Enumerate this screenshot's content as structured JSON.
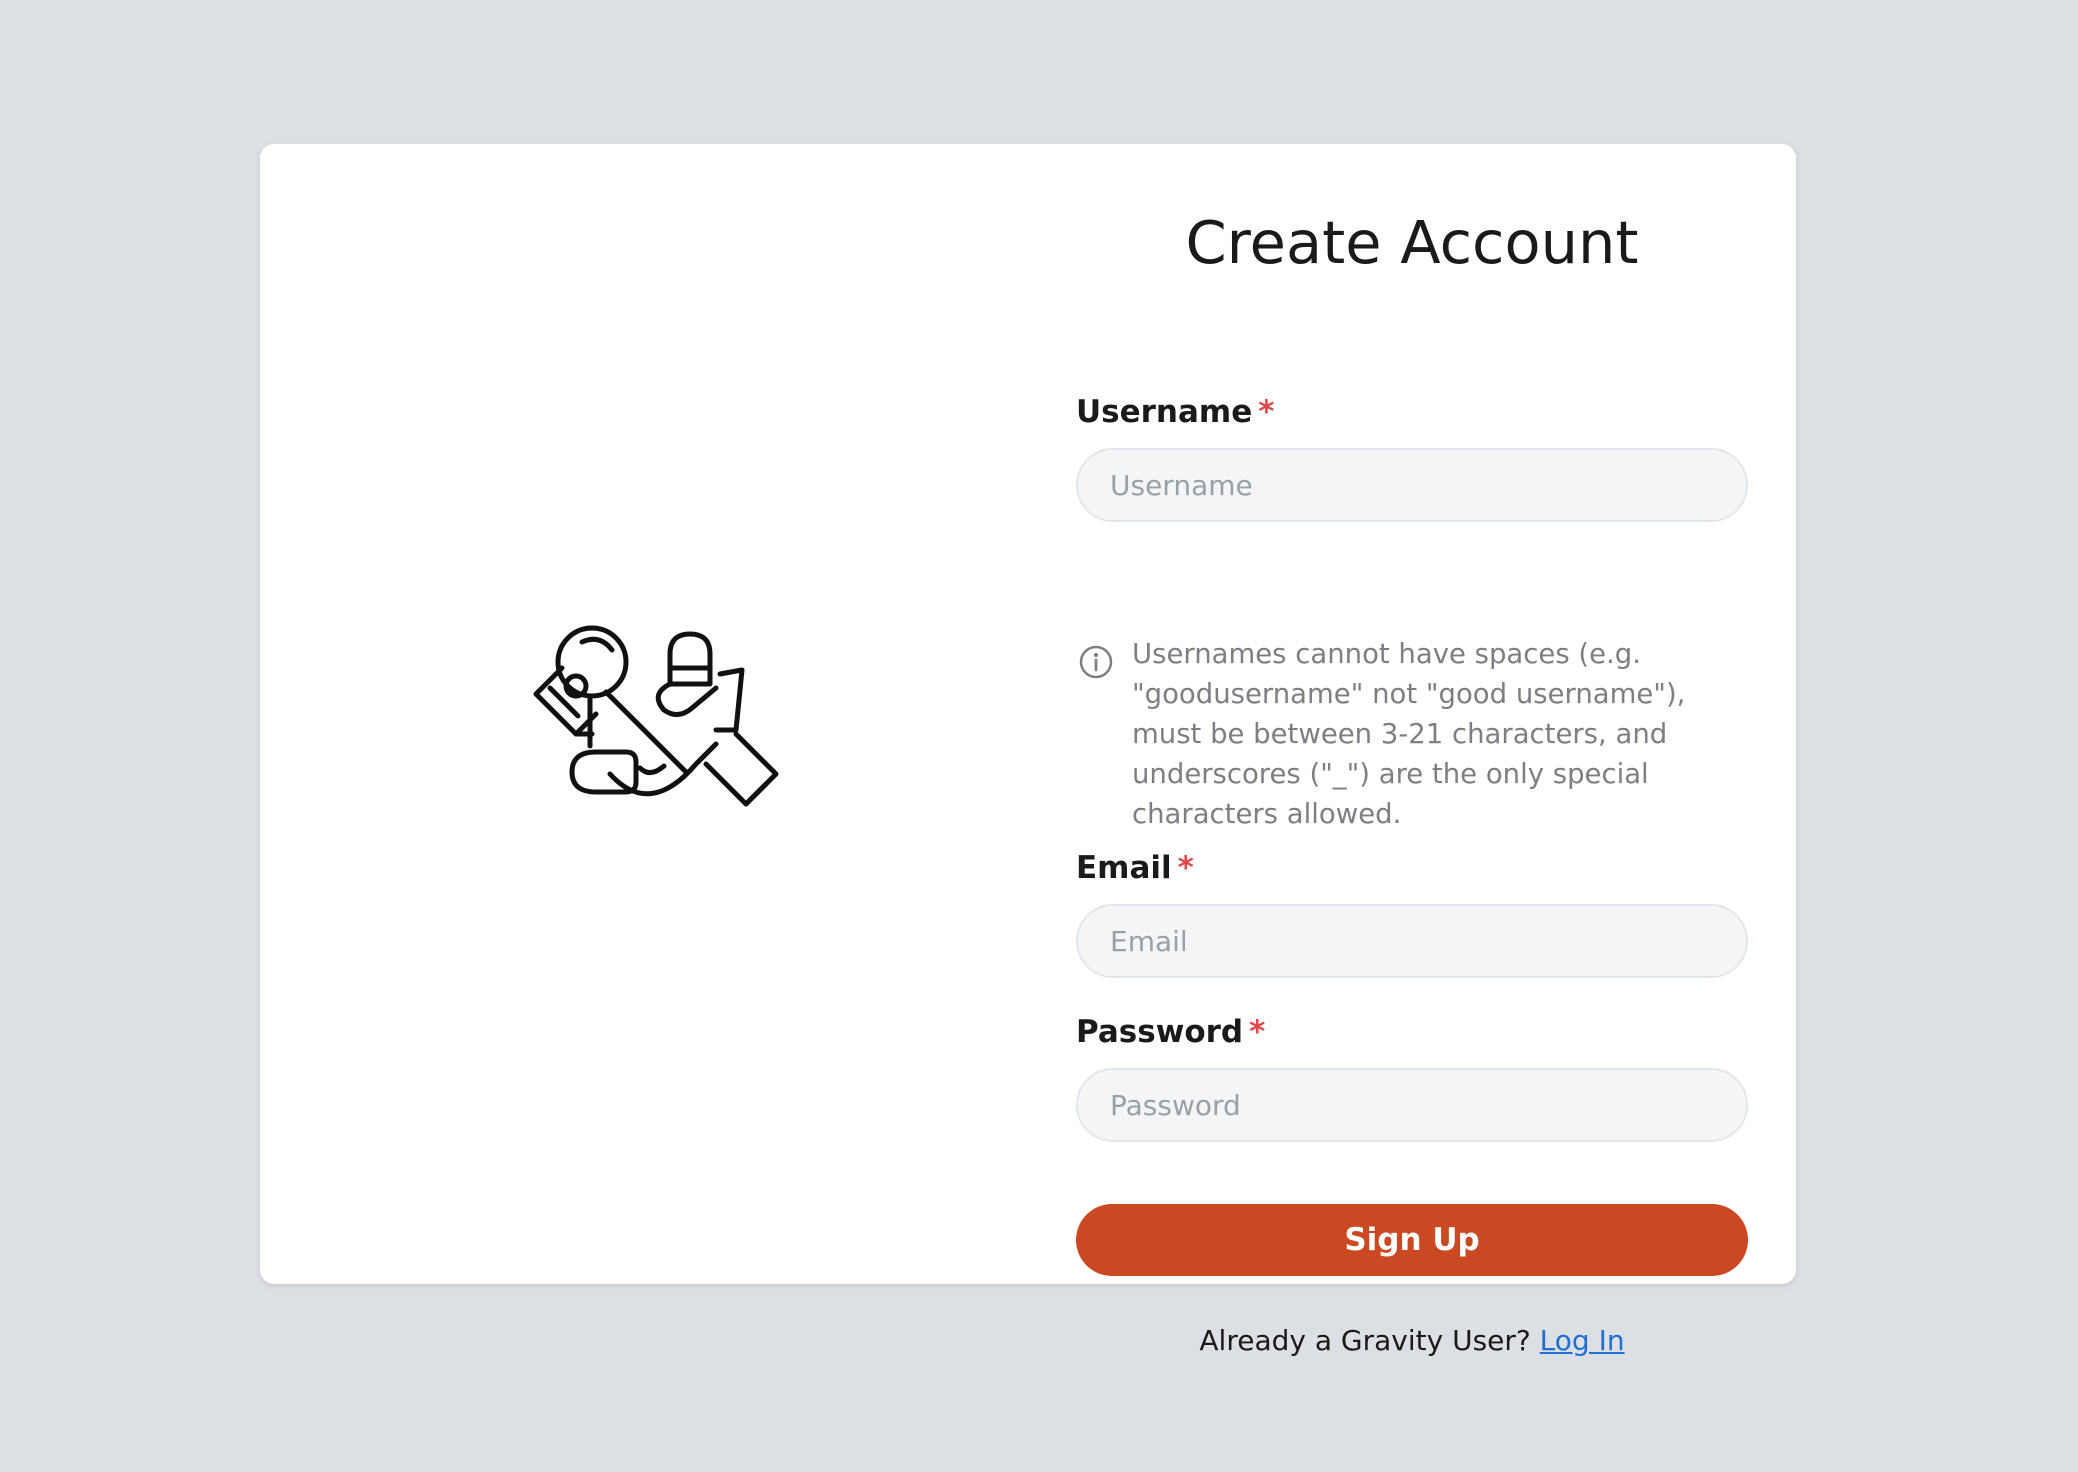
{
  "title": "Create Account",
  "username": {
    "label": "Username",
    "required_mark": "*",
    "placeholder": "Username",
    "value": "",
    "hint": "Usernames cannot have spaces (e.g. \"goodusername\" not \"good username\"), must be between 3-21 characters, and underscores (\"_\") are the only special characters allowed."
  },
  "email": {
    "label": "Email",
    "required_mark": "*",
    "placeholder": "Email",
    "value": ""
  },
  "password": {
    "label": "Password",
    "required_mark": "*",
    "placeholder": "Password",
    "value": ""
  },
  "signup_button": "Sign Up",
  "footer": {
    "text": "Already a Gravity User?",
    "link": "Log In"
  },
  "colors": {
    "background": "#dce0e4",
    "card": "#ffffff",
    "accent": "#cb4922",
    "required": "#e0474c",
    "link": "#1f6fd6"
  },
  "icons": {
    "illustration": "astronaut-icon",
    "hint": "info-icon"
  }
}
